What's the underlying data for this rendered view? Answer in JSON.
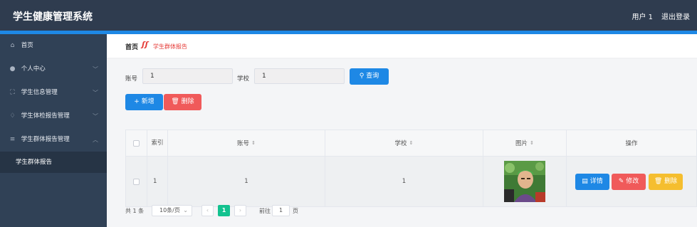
{
  "header": {
    "title": "学生健康管理系统",
    "user": "用户 1",
    "logout": "退出登录"
  },
  "sidebar": {
    "items": [
      {
        "icon": "home-icon",
        "glyph": "⌂",
        "label": "首页"
      },
      {
        "icon": "person-icon",
        "glyph": "●",
        "label": "个人中心",
        "chevron": "﹀"
      },
      {
        "icon": "frame-icon",
        "glyph": "⛶",
        "label": "学生信息管理",
        "chevron": "﹀"
      },
      {
        "icon": "bell-icon",
        "glyph": "♢",
        "label": "学生体检报告管理",
        "chevron": "﹀"
      },
      {
        "icon": "list-icon",
        "glyph": "≡",
        "label": "学生群体报告管理",
        "chevron": "︿"
      }
    ],
    "sub_item": "学生群体报告"
  },
  "breadcrumb": {
    "home": "首页",
    "separator": "ʃʃ",
    "current": "学生群体报告"
  },
  "search": {
    "account_label": "账号",
    "account_value": "1",
    "school_label": "学校",
    "school_value": "1",
    "query_label": "查询"
  },
  "actions": {
    "add_label": "新增",
    "delete_label": "删除"
  },
  "table": {
    "headers": {
      "index": "索引",
      "account": "账号",
      "school": "学校",
      "image": "图片",
      "ops": "操作"
    },
    "sort_glyph": "⇕",
    "rows": [
      {
        "index": "1",
        "account": "1",
        "school": "1"
      }
    ],
    "row_buttons": {
      "detail": "详情",
      "edit": "修改",
      "delete": "删除"
    }
  },
  "pagination": {
    "total": "共 1 条",
    "page_size": "10条/页",
    "current_page": "1",
    "goto_prefix": "前往",
    "goto_value": "1",
    "goto_suffix": "页"
  },
  "colors": {
    "accent": "#1e88e5",
    "danger": "#f05a5a",
    "warning": "#f5be2f",
    "pager_active": "#13c28f"
  }
}
